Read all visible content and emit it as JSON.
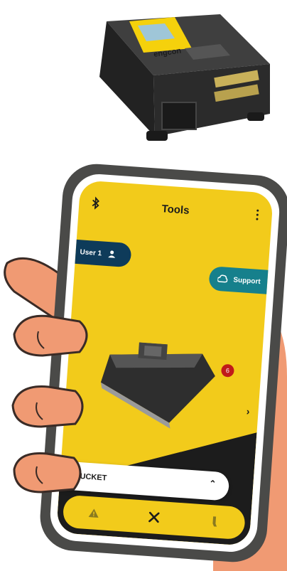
{
  "device": {
    "brand": "engcon"
  },
  "app": {
    "title": "Tools",
    "user_button": "User 1",
    "support_button": "Support",
    "tool_badge": "6",
    "selected_tool": "BUCKET"
  },
  "icons": {
    "bluetooth": "bluetooth-icon",
    "menu": "more-vert-icon",
    "user": "person-icon",
    "support": "support-icon",
    "next": "chevron-right-icon",
    "expand": "chevron-up-icon",
    "nav": [
      "warning-icon",
      "tools-icon",
      "tiltrotator-icon"
    ]
  },
  "colors": {
    "screen_yellow": "#f2cb1b",
    "user_blue": "#0e3b5a",
    "support_teal": "#16808c",
    "badge_red": "#c01a1a",
    "phone_frame": "#4a4a48",
    "skin": "#f09a73"
  }
}
